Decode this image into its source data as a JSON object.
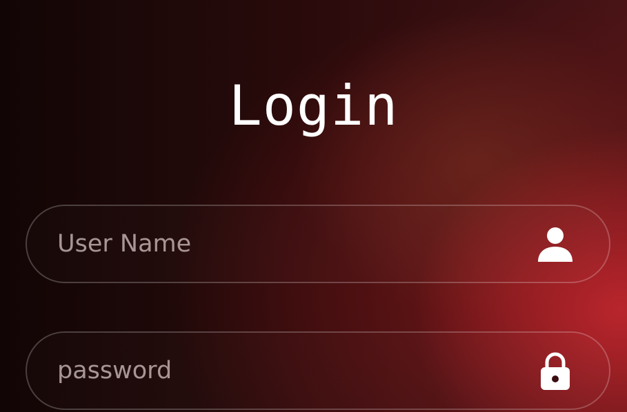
{
  "title": "Login",
  "username": {
    "placeholder": "User Name",
    "value": "",
    "icon": "user-icon"
  },
  "password": {
    "placeholder": "password",
    "value": "",
    "icon": "lock-icon"
  },
  "colors": {
    "text": "#ffffff",
    "accent": "#c8282e",
    "background_dark": "#120505"
  }
}
